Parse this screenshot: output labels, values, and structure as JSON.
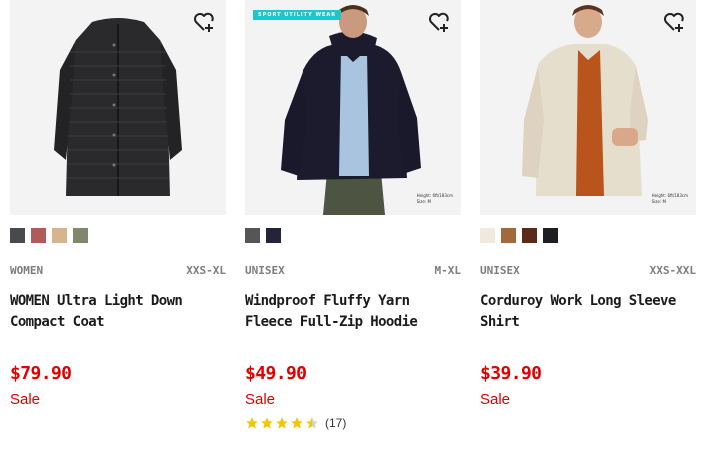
{
  "products": [
    {
      "gender": "WOMEN",
      "sizes": "XXS-XL",
      "name": "WOMEN Ultra Light Down Compact Coat",
      "price": "$79.90",
      "sale_label": "Sale",
      "swatches": [
        "#4a4a4e",
        "#b05a5c",
        "#d6b58c",
        "#7f876d"
      ],
      "image_alt": "black quilted long down coat"
    },
    {
      "gender": "UNISEX",
      "sizes": "M-XL",
      "name": "Windproof Fluffy Yarn Fleece Full-Zip Hoodie",
      "price": "$49.90",
      "sale_label": "Sale",
      "swatches": [
        "#565658",
        "#23233a"
      ],
      "rating": {
        "stars": 4.5,
        "count": "(17)"
      },
      "tag": "SPORT UTILITY WEAR",
      "size_note": [
        "Height: 6ft/183cm",
        "Size: M"
      ]
    },
    {
      "gender": "UNISEX",
      "sizes": "XXS-XXL",
      "name": "Corduroy Work Long Sleeve Shirt",
      "price": "$39.90",
      "sale_label": "Sale",
      "swatches": [
        "#efe9de",
        "#a3693a",
        "#5a2b1b",
        "#1e1e22"
      ],
      "size_note": [
        "Height: 6ft/183cm",
        "Size: M"
      ]
    }
  ],
  "colors": {
    "sale_red": "#e00000",
    "star_gold": "#f6c400",
    "image_bg": "#f3f3f3"
  },
  "icons": {
    "favorite": "heart-plus-icon",
    "star": "star-icon"
  }
}
